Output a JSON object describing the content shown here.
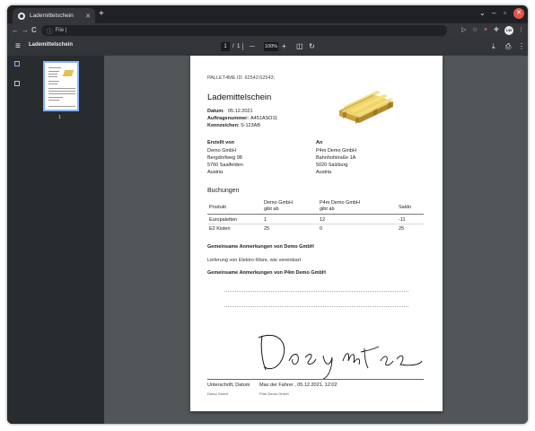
{
  "browser": {
    "tab_title": "Lademittelschein",
    "new_tab": "+",
    "url": "File |",
    "avatar": "LW",
    "window_controls": {
      "minimize": "–",
      "maximize": "▫",
      "close": "✕",
      "tab_search": "⌄"
    },
    "nav": {
      "back": "←",
      "forward": "→",
      "reload": "C",
      "info": "ⓘ"
    },
    "icons": [
      "share-icon",
      "bookmark-star-icon",
      "extension-icon",
      "puzzle-icon",
      "profile-avatar",
      "kebab-menu-icon"
    ]
  },
  "pdf_toolbar": {
    "title": "Lademittelschein",
    "page_current": "1",
    "page_sep": "/",
    "page_total": "1",
    "zoom_out": "—",
    "zoom": "100%",
    "zoom_in": "+",
    "download": "⤓",
    "print": "⎙",
    "more": "⋮"
  },
  "sidebar": {
    "thumb_page_number": "1"
  },
  "document": {
    "id_line": "PALLET4ME ID: 62542;62543;",
    "title": "Lademittelschein",
    "meta": [
      {
        "label": "Datum:",
        "value": "05.12.2021"
      },
      {
        "label": "Auftragsnummer:",
        "value": "A451ASO11"
      },
      {
        "label": "Kennzeichen:",
        "value": "S-123AB"
      }
    ],
    "from": {
      "heading": "Erstellt von",
      "lines": [
        "Demo GmbH",
        "Bergdorfweg 98",
        "5760 Saalfelden",
        "Austria"
      ]
    },
    "to": {
      "heading": "An",
      "lines": [
        "P4m Demo GmbH",
        "Bahnhofstraße 1A",
        "5020 Salzburg",
        "Austria"
      ]
    },
    "bookings_heading": "Buchungen",
    "table": {
      "headers": [
        "Produkt",
        "Demo GmbH\ngibt ab",
        "P4m Demo GmbH\ngibt ab",
        "Saldo"
      ],
      "header_line1": [
        "Produkt",
        "Demo GmbH",
        "P4m Demo GmbH",
        "Saldo"
      ],
      "header_line2": [
        "",
        "gibt ab",
        "gibt ab",
        ""
      ],
      "rows": [
        [
          "Europaletten",
          "1",
          "12",
          "-11"
        ],
        [
          "E2 Kisten",
          "25",
          "0",
          "25"
        ]
      ]
    },
    "remarks_heading_1": "Gemeinsame Anmerkungen von Demo GmbH",
    "remarks_text_1": "Lieferung von Elektro-Ware, wie vereinbart",
    "remarks_heading_2": "Gemeinsame Anmerkungen von P4m Demo GmbH",
    "signature_left_label": "Unterschrift, Datum",
    "signature_right_label": "Max der Fahrer , 05.12.2021, 12:02",
    "signature_left_company": "Demo GmbH",
    "signature_right_company": "P4m Demo GmbH"
  },
  "colors": {
    "frame": "#202124",
    "toolbar": "#35363a",
    "pdf_toolbar": "#323639",
    "viewer_bg": "#525659",
    "sidebar_bg": "#292c2e",
    "accent": "#8ab4f8",
    "pallet": "#e3c24e",
    "close_button": "#e2564a"
  }
}
